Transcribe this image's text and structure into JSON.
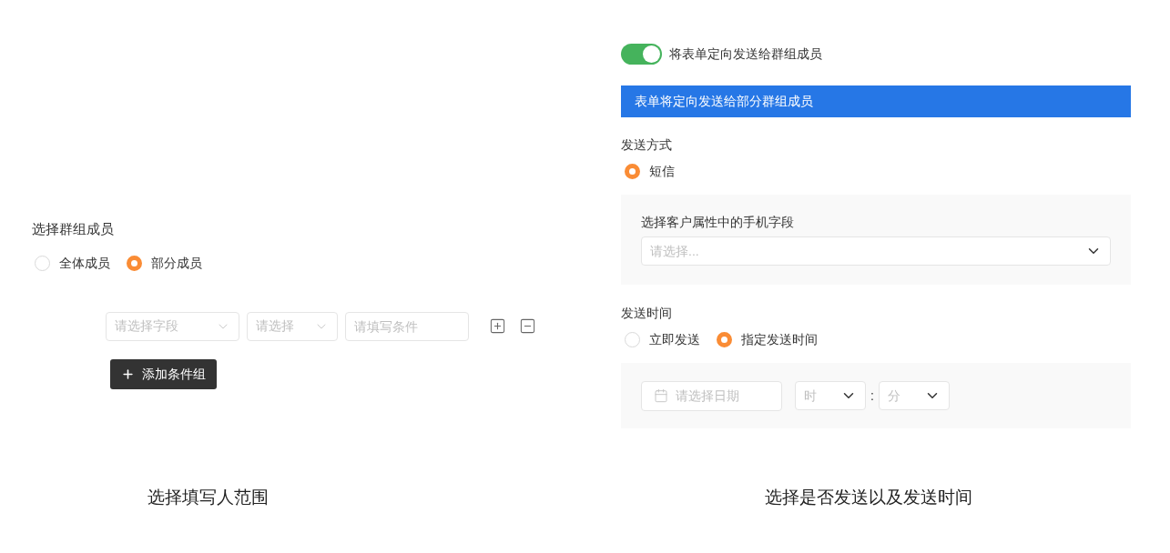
{
  "left": {
    "section_label": "选择群组成员",
    "member_options": [
      {
        "label": "全体成员",
        "selected": false
      },
      {
        "label": "部分成员",
        "selected": true
      }
    ],
    "condition_row": {
      "field_select": {
        "placeholder": "请选择字段"
      },
      "operator_select": {
        "placeholder": "请选择"
      },
      "value_input": {
        "placeholder": "请填写条件"
      }
    },
    "add_group_button": {
      "label": "添加条件组"
    },
    "caption": "选择填写人范围"
  },
  "right": {
    "toggle": {
      "on": true,
      "label": "将表单定向发送给群组成员"
    },
    "banner": "表单将定向发送给部分群组成员",
    "send_method": {
      "label": "发送方式",
      "options": [
        {
          "label": "短信",
          "selected": true
        }
      ]
    },
    "phone_field": {
      "label": "选择客户属性中的手机字段",
      "placeholder": "请选择..."
    },
    "send_time": {
      "label": "发送时间",
      "options": [
        {
          "label": "立即发送",
          "selected": false
        },
        {
          "label": "指定发送时间",
          "selected": true
        }
      ]
    },
    "schedule": {
      "date_placeholder": "请选择日期",
      "hour_placeholder": "时",
      "separator": ":",
      "minute_placeholder": "分"
    },
    "caption": "选择是否发送以及发送时间"
  }
}
